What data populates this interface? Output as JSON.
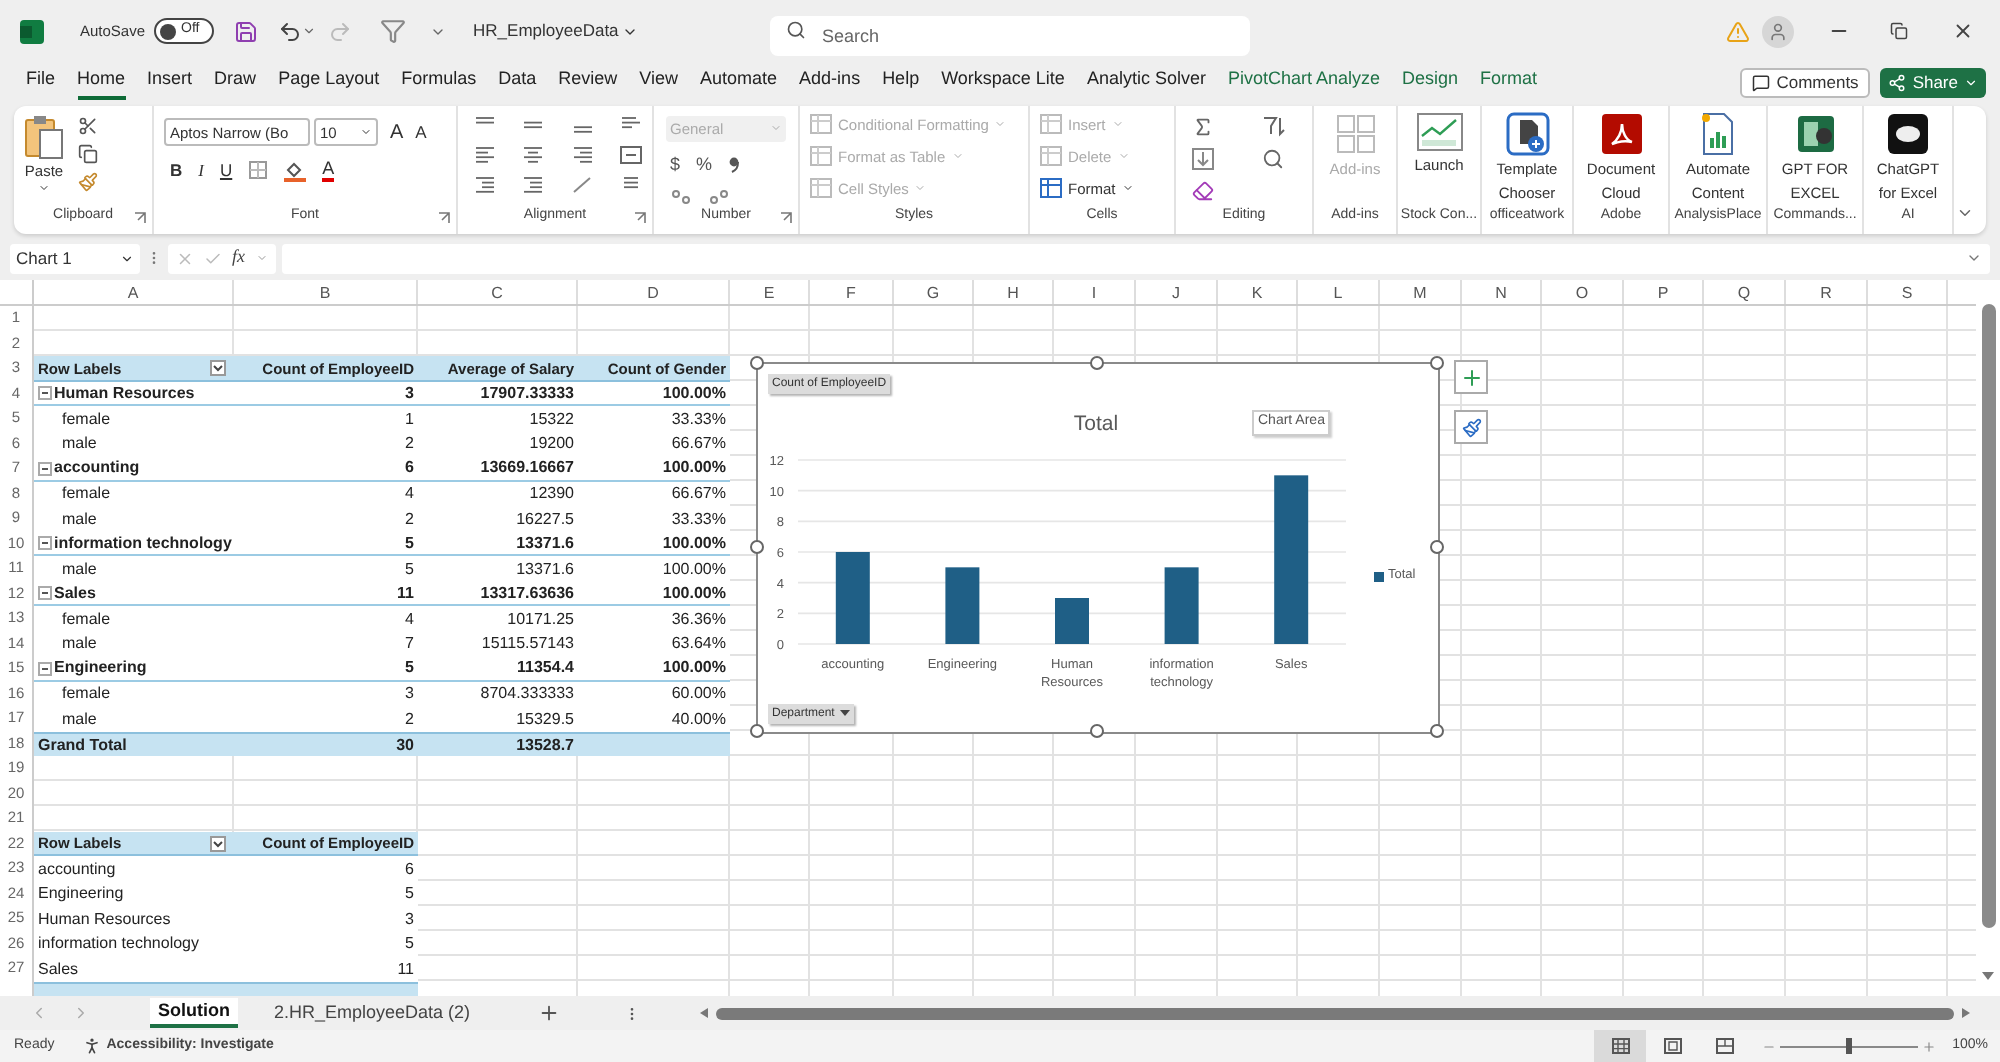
{
  "title_bar": {
    "autosave_label": "AutoSave",
    "autosave_on": false,
    "autosave_state": "Off",
    "file_name": "HR_EmployeeData",
    "search_placeholder": "Search"
  },
  "menu_tabs": [
    {
      "label": "File",
      "selected": false,
      "contextual": false
    },
    {
      "label": "Home",
      "selected": true,
      "contextual": false
    },
    {
      "label": "Insert",
      "selected": false,
      "contextual": false
    },
    {
      "label": "Draw",
      "selected": false,
      "contextual": false
    },
    {
      "label": "Page Layout",
      "selected": false,
      "contextual": false
    },
    {
      "label": "Formulas",
      "selected": false,
      "contextual": false
    },
    {
      "label": "Data",
      "selected": false,
      "contextual": false
    },
    {
      "label": "Review",
      "selected": false,
      "contextual": false
    },
    {
      "label": "View",
      "selected": false,
      "contextual": false
    },
    {
      "label": "Automate",
      "selected": false,
      "contextual": false
    },
    {
      "label": "Add-ins",
      "selected": false,
      "contextual": false
    },
    {
      "label": "Help",
      "selected": false,
      "contextual": false
    },
    {
      "label": "Workspace Lite",
      "selected": false,
      "contextual": false
    },
    {
      "label": "Analytic Solver",
      "selected": false,
      "contextual": false
    },
    {
      "label": "PivotChart Analyze",
      "selected": false,
      "contextual": true
    },
    {
      "label": "Design",
      "selected": false,
      "contextual": true
    },
    {
      "label": "Format",
      "selected": false,
      "contextual": true
    }
  ],
  "comments_button": "Comments",
  "share_button": "Share",
  "ribbon": {
    "groups": [
      {
        "kind": "clipboard",
        "label": "Clipboard",
        "dialog_launcher": true,
        "paste": "Paste"
      },
      {
        "kind": "font",
        "label": "Font",
        "dialog_launcher": true,
        "font_name": "Aptos Narrow (Bo",
        "font_size": "10",
        "grow_font": "A",
        "shrink_font": "A",
        "bold": "B",
        "italic": "I",
        "underline": "U",
        "font_color": "A"
      },
      {
        "kind": "alignment",
        "label": "Alignment",
        "dialog_launcher": true
      },
      {
        "kind": "number",
        "label": "Number",
        "dialog_launcher": true,
        "format": "General",
        "format_disabled": true,
        "currency": "$",
        "percent": "%"
      },
      {
        "kind": "list",
        "label": "Styles",
        "dialog_launcher": false,
        "items": [
          {
            "label": "Conditional Formatting",
            "disabled": true
          },
          {
            "label": "Format as Table",
            "disabled": true
          },
          {
            "label": "Cell Styles",
            "disabled": true
          }
        ]
      },
      {
        "kind": "list",
        "label": "Cells",
        "dialog_launcher": false,
        "items": [
          {
            "label": "Insert",
            "disabled": true
          },
          {
            "label": "Delete",
            "disabled": true
          },
          {
            "label": "Format",
            "disabled": false
          }
        ]
      },
      {
        "kind": "editing",
        "label": "Editing",
        "dialog_launcher": false
      },
      {
        "kind": "big",
        "label": "Add-ins",
        "dialog_launcher": false,
        "lines": [
          "Add-ins"
        ],
        "disabled": true
      },
      {
        "kind": "big",
        "label": "Stock Con...",
        "dialog_launcher": false,
        "lines": [
          "Launch"
        ],
        "disabled": false
      },
      {
        "kind": "big",
        "label": "officeatwork",
        "dialog_launcher": false,
        "lines": [
          "Template",
          "Chooser"
        ],
        "disabled": false
      },
      {
        "kind": "big",
        "label": "Adobe",
        "dialog_launcher": false,
        "lines": [
          "Document",
          "Cloud"
        ],
        "disabled": false
      },
      {
        "kind": "big",
        "label": "AnalysisPlace",
        "dialog_launcher": false,
        "lines": [
          "Automate",
          "Content"
        ],
        "disabled": false
      },
      {
        "kind": "big",
        "label": "Commands...",
        "dialog_launcher": false,
        "lines": [
          "GPT FOR",
          "EXCEL"
        ],
        "disabled": false
      },
      {
        "kind": "big",
        "label": "AI",
        "dialog_launcher": false,
        "lines": [
          "ChatGPT",
          "for Excel"
        ],
        "disabled": false
      }
    ]
  },
  "formula_bar": {
    "name_box": "Chart 1",
    "fx": "fx"
  },
  "sheet": {
    "columns": [
      "A",
      "B",
      "C",
      "D",
      "E",
      "F",
      "G",
      "H",
      "I",
      "J",
      "K",
      "L",
      "M",
      "N",
      "O",
      "P",
      "Q",
      "R",
      "S"
    ],
    "row_numbers": [
      "1",
      "2",
      "3",
      "4",
      "5",
      "6",
      "7",
      "8",
      "9",
      "10",
      "11",
      "12",
      "13",
      "14",
      "15",
      "16",
      "17",
      "18",
      "19",
      "20",
      "21",
      "22",
      "23",
      "24",
      "25",
      "26",
      "27"
    ],
    "pivot_tables": [
      {
        "headers": [
          "Row Labels",
          "Count of EmployeeID",
          "Average of Salary",
          "Count of Gender"
        ],
        "rows": [
          {
            "kind": "group",
            "label": "Human Resources",
            "expanded": true,
            "values": [
              "3",
              "17907.33333",
              "100.00%"
            ]
          },
          {
            "kind": "item",
            "label": "female",
            "values": [
              "1",
              "15322",
              "33.33%"
            ]
          },
          {
            "kind": "item",
            "label": "male",
            "values": [
              "2",
              "19200",
              "66.67%"
            ]
          },
          {
            "kind": "group",
            "label": "accounting",
            "expanded": true,
            "values": [
              "6",
              "13669.16667",
              "100.00%"
            ]
          },
          {
            "kind": "item",
            "label": "female",
            "values": [
              "4",
              "12390",
              "66.67%"
            ]
          },
          {
            "kind": "item",
            "label": "male",
            "values": [
              "2",
              "16227.5",
              "33.33%"
            ]
          },
          {
            "kind": "group",
            "label": "information technology",
            "expanded": true,
            "values": [
              "5",
              "13371.6",
              "100.00%"
            ]
          },
          {
            "kind": "item",
            "label": "male",
            "values": [
              "5",
              "13371.6",
              "100.00%"
            ]
          },
          {
            "kind": "group",
            "label": "Sales",
            "expanded": true,
            "values": [
              "11",
              "13317.63636",
              "100.00%"
            ]
          },
          {
            "kind": "item",
            "label": "female",
            "values": [
              "4",
              "10171.25",
              "36.36%"
            ]
          },
          {
            "kind": "item",
            "label": "male",
            "values": [
              "7",
              "15115.57143",
              "63.64%"
            ]
          },
          {
            "kind": "group",
            "label": "Engineering",
            "expanded": true,
            "values": [
              "5",
              "11354.4",
              "100.00%"
            ]
          },
          {
            "kind": "item",
            "label": "female",
            "values": [
              "3",
              "8704.333333",
              "60.00%"
            ]
          },
          {
            "kind": "item",
            "label": "male",
            "values": [
              "2",
              "15329.5",
              "40.00%"
            ]
          },
          {
            "kind": "total",
            "label": "Grand Total",
            "values": [
              "30",
              "13528.7"
            ]
          }
        ]
      },
      {
        "headers": [
          "Row Labels",
          "Count of EmployeeID"
        ],
        "rows": [
          {
            "kind": "plain",
            "label": "accounting",
            "values": [
              "6"
            ]
          },
          {
            "kind": "plain",
            "label": "Engineering",
            "values": [
              "5"
            ]
          },
          {
            "kind": "plain",
            "label": "Human Resources",
            "values": [
              "3"
            ]
          },
          {
            "kind": "plain",
            "label": "information technology",
            "values": [
              "5"
            ]
          },
          {
            "kind": "plain",
            "label": "Sales",
            "values": [
              "11"
            ]
          }
        ]
      }
    ]
  },
  "chart": {
    "field_button": "Count of EmployeeID",
    "axis_button": "Department",
    "tooltip": "Chart Area",
    "chart_data": {
      "type": "bar",
      "title": "Total",
      "categories": [
        "accounting",
        "Engineering",
        "Human Resources",
        "information technology",
        "Sales"
      ],
      "series": [
        {
          "name": "Total",
          "color": "#1f5f86",
          "values": [
            6,
            5,
            3,
            5,
            11
          ]
        }
      ],
      "grid": true,
      "ylim": [
        0,
        12
      ],
      "yticks": [
        0,
        2,
        4,
        6,
        8,
        10,
        12
      ]
    }
  },
  "sheet_tabs": [
    {
      "label": "Solution",
      "selected": true
    },
    {
      "label": "2.HR_EmployeeData (2)",
      "selected": false
    }
  ],
  "status_bar": {
    "ready": "Ready",
    "accessibility": "Accessibility: Investigate",
    "view_buttons": [
      {
        "selected": true
      },
      {
        "selected": false
      },
      {
        "selected": false
      }
    ],
    "zoom_slider": {
      "level": 0.5
    },
    "zoom": "100%"
  }
}
